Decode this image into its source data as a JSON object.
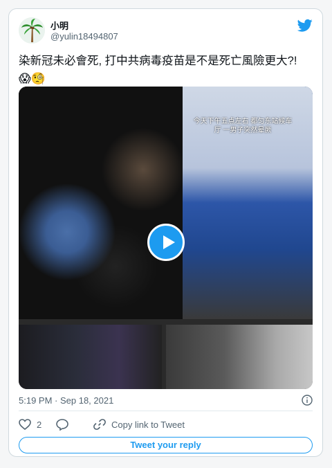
{
  "tweet": {
    "author_name": "小明",
    "author_handle": "@yulin18494807",
    "text": "染新冠未必會死, 打中共病毒疫苗是不是死亡風險更大?!",
    "emoji": "😱🧐",
    "video_overlay_text": "今天下午五点左右 都匀东站候车厅 一男子突然晕厥",
    "timestamp": "5:19 PM · Sep 18, 2021",
    "like_count": "2",
    "copy_link_label": "Copy link to Tweet",
    "reply_button_label": "Tweet your reply"
  },
  "icons": {
    "avatar": "palm-tree-icon",
    "brand": "twitter-bird-icon",
    "play": "play-icon",
    "info": "info-icon",
    "like": "heart-icon",
    "reply": "speech-bubble-icon",
    "link": "link-icon"
  },
  "colors": {
    "accent": "#1d9bf0",
    "text_primary": "#0f1419",
    "text_secondary": "#536471",
    "border": "#cfd9de"
  }
}
